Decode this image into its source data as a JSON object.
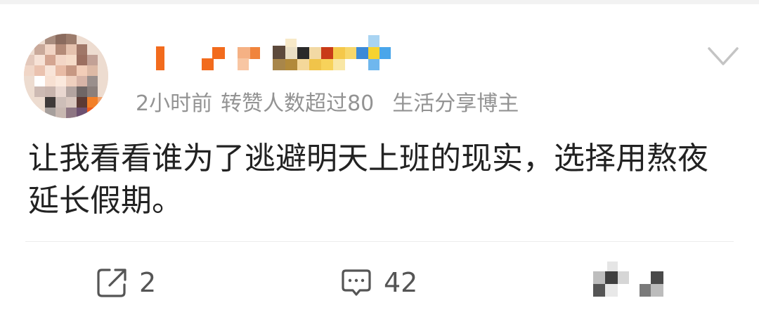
{
  "post": {
    "time": "2小时前",
    "repost_status": "转赞人数超过80",
    "user_tag": "生活分享博主",
    "text": "让我看看谁为了逃避明天上班的现实，选择用熬夜延长假期。"
  },
  "actions": {
    "repost_count": "2",
    "comment_count": "42"
  },
  "icons": {
    "avatar": "pixelated-avatar",
    "username": "pixelated-username",
    "menu": "chevron-down-icon",
    "repost": "share-icon",
    "comment": "comment-icon",
    "like": "pixelated-like-icon"
  },
  "colors": {
    "text": "#222222",
    "meta": "#939393",
    "action": "#555555",
    "divider": "#ececec",
    "username_orange": "#f26b1d"
  }
}
